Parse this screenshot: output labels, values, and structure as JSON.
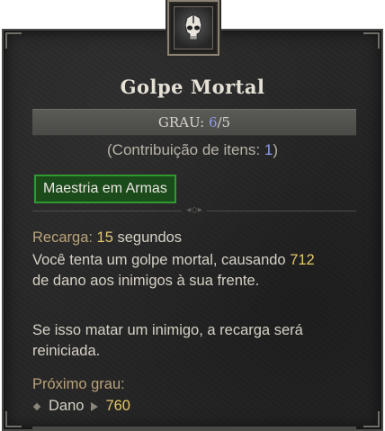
{
  "skill": {
    "icon": "skull-helm-icon",
    "name": "Golpe Mortal",
    "grade_label": "GRAU:",
    "grade_current": "6",
    "grade_max": "/5",
    "contrib_prefix": "(Contribuição de itens: ",
    "contrib_value": "1",
    "contrib_suffix": ")",
    "tag": "Maestria em Armas",
    "cooldown_label": "Recarga:",
    "cooldown_value": "15",
    "cooldown_unit": "segundos",
    "desc_part1": "Você tenta um golpe mortal, causando ",
    "desc_damage": "712",
    "desc_part2": "de dano aos inimigos à sua frente.",
    "desc_extra": "Se isso matar um inimigo, a recarga será reiniciada.",
    "next_grade_label": "Próximo grau:",
    "next_stat_name": "Dano",
    "next_stat_value": "760"
  },
  "colors": {
    "panel_bg": "#262626",
    "highlight_gold": "#e5c769",
    "grade_blue": "#8d9bf2",
    "tag_green": "#2f9a2f"
  }
}
